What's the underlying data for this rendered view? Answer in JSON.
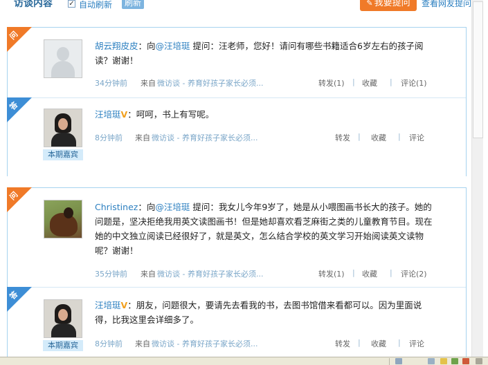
{
  "header": {
    "title": "访谈内容",
    "checkbox_mark": "✓",
    "auto_refresh": "自动刷新",
    "refresh_button": "刷新",
    "ask_icon": "✎",
    "ask_button": "我要提问",
    "view_questions": "查看网友提问"
  },
  "labels": {
    "question_tag": "问",
    "answer_tag": "答",
    "guest_badge": "本期嘉宾",
    "from": "来自",
    "source_link": "微访谈 - 养育好孩子家长必须...",
    "pipe": "|"
  },
  "qa": [
    {
      "question": {
        "author": "胡云翔皮皮",
        "prefix": "：向",
        "target": "@汪培珽",
        "body": " 提问：汪老师，您好！请问有哪些书籍适合6岁左右的孩子阅读？谢谢！",
        "time": "34分钟前",
        "forward": "转发(1)",
        "favorite": "收藏",
        "comment": "评论(1)"
      },
      "answer": {
        "author": "汪培珽",
        "vip_mark": "V",
        "body": "：呵呵，书上有写呢。",
        "time": "8分钟前",
        "forward": "转发",
        "favorite": "收藏",
        "comment": "评论"
      }
    },
    {
      "question": {
        "author": "Christinez",
        "prefix": "：向",
        "target": "@汪培珽",
        "body": " 提问：我女儿今年9岁了，她是从小喂图画书长大的孩子。她的问题是，坚决拒绝我用英文读图画书！但是她却喜欢看芝麻街之类的儿童教育节目。现在她的中文独立阅读已经很好了，就是英文，怎么结合学校的英文学习开始阅读英文读物呢？谢谢！",
        "time": "35分钟前",
        "forward": "转发(1)",
        "favorite": "收藏",
        "comment": "评论(2)"
      },
      "answer": {
        "author": "汪培珽",
        "vip_mark": "V",
        "body": "：朋友，问题很大，要请先去看我的书，去图书馆借来看都可以。因为里面说得，比我这里会详细多了。",
        "time": "8分钟前",
        "forward": "转发",
        "favorite": "收藏",
        "comment": "评论"
      }
    }
  ]
}
